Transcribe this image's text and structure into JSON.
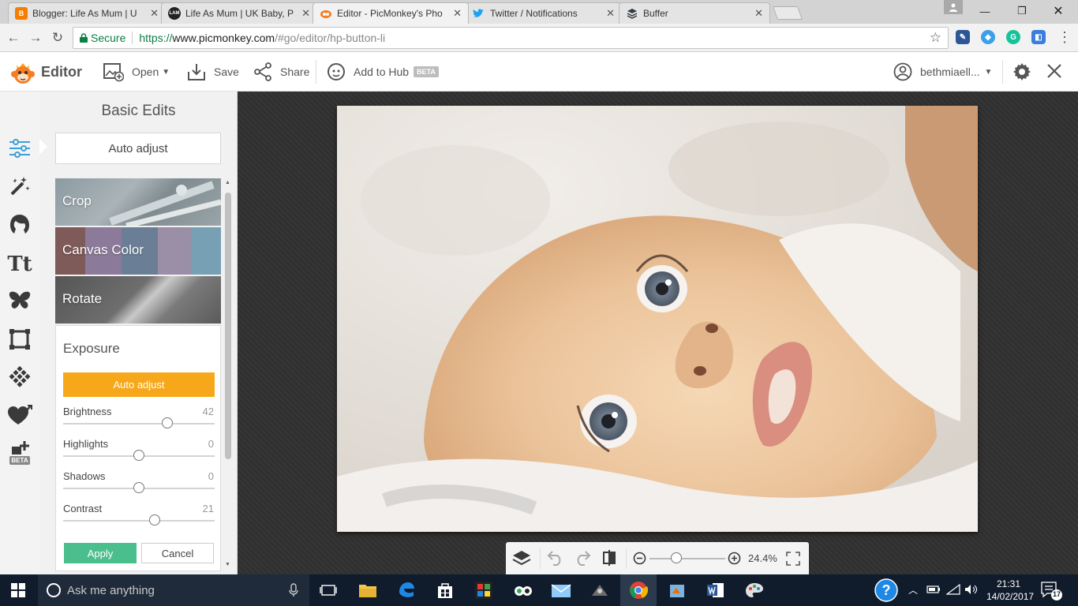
{
  "browser": {
    "tabs": [
      {
        "title": "Blogger: Life As Mum | U",
        "favicon": "blogger-icon",
        "color": "#f57d00",
        "glyph": "B"
      },
      {
        "title": "Life As Mum | UK Baby, P",
        "favicon": "lam-icon",
        "color": "#222222",
        "glyph": "LAM"
      },
      {
        "title": "Editor - PicMonkey's Pho",
        "favicon": "picmonkey-icon",
        "color": "#f57d24",
        "glyph": ""
      },
      {
        "title": "Twitter / Notifications",
        "favicon": "twitter-icon",
        "color": "#1da1f2",
        "glyph": ""
      },
      {
        "title": "Buffer",
        "favicon": "buffer-icon",
        "color": "#323b43",
        "glyph": ""
      }
    ],
    "close_glyph": "✕",
    "secure_label": "Secure",
    "url_scheme": "https://",
    "url_host": "www.picmonkey.com",
    "url_path": "/#go/editor/hp-button-li"
  },
  "header": {
    "brand": "Editor",
    "open_label": "Open",
    "save_label": "Save",
    "share_label": "Share",
    "hub_label": "Add to Hub",
    "hub_badge": "BETA",
    "username": "bethmiaell..."
  },
  "tools": {
    "beta_badge": "BETA",
    "text_tool_glyph": "Tt"
  },
  "panel": {
    "title": "Basic Edits",
    "auto_adjust_label": "Auto adjust",
    "tiles": [
      "Crop",
      "Canvas Color",
      "Rotate"
    ],
    "exposure": {
      "title": "Exposure",
      "auto_adjust_label": "Auto adjust",
      "sliders": [
        {
          "label": "Brightness",
          "value": "42",
          "position": 0.69
        },
        {
          "label": "Highlights",
          "value": "0",
          "position": 0.5
        },
        {
          "label": "Shadows",
          "value": "0",
          "position": 0.5
        },
        {
          "label": "Contrast",
          "value": "21",
          "position": 0.605
        }
      ],
      "apply_label": "Apply",
      "cancel_label": "Cancel"
    }
  },
  "zoom": {
    "value": "24.4%",
    "position": 0.35
  },
  "taskbar": {
    "search_placeholder": "Ask me anything",
    "time": "21:31",
    "date": "14/02/2017",
    "notification_count": "17"
  },
  "colors": {
    "accent_orange": "#f6a81a",
    "apply_green": "#4bbe8e",
    "brand_orange": "#f57d24",
    "secure_green": "#0b8043"
  }
}
